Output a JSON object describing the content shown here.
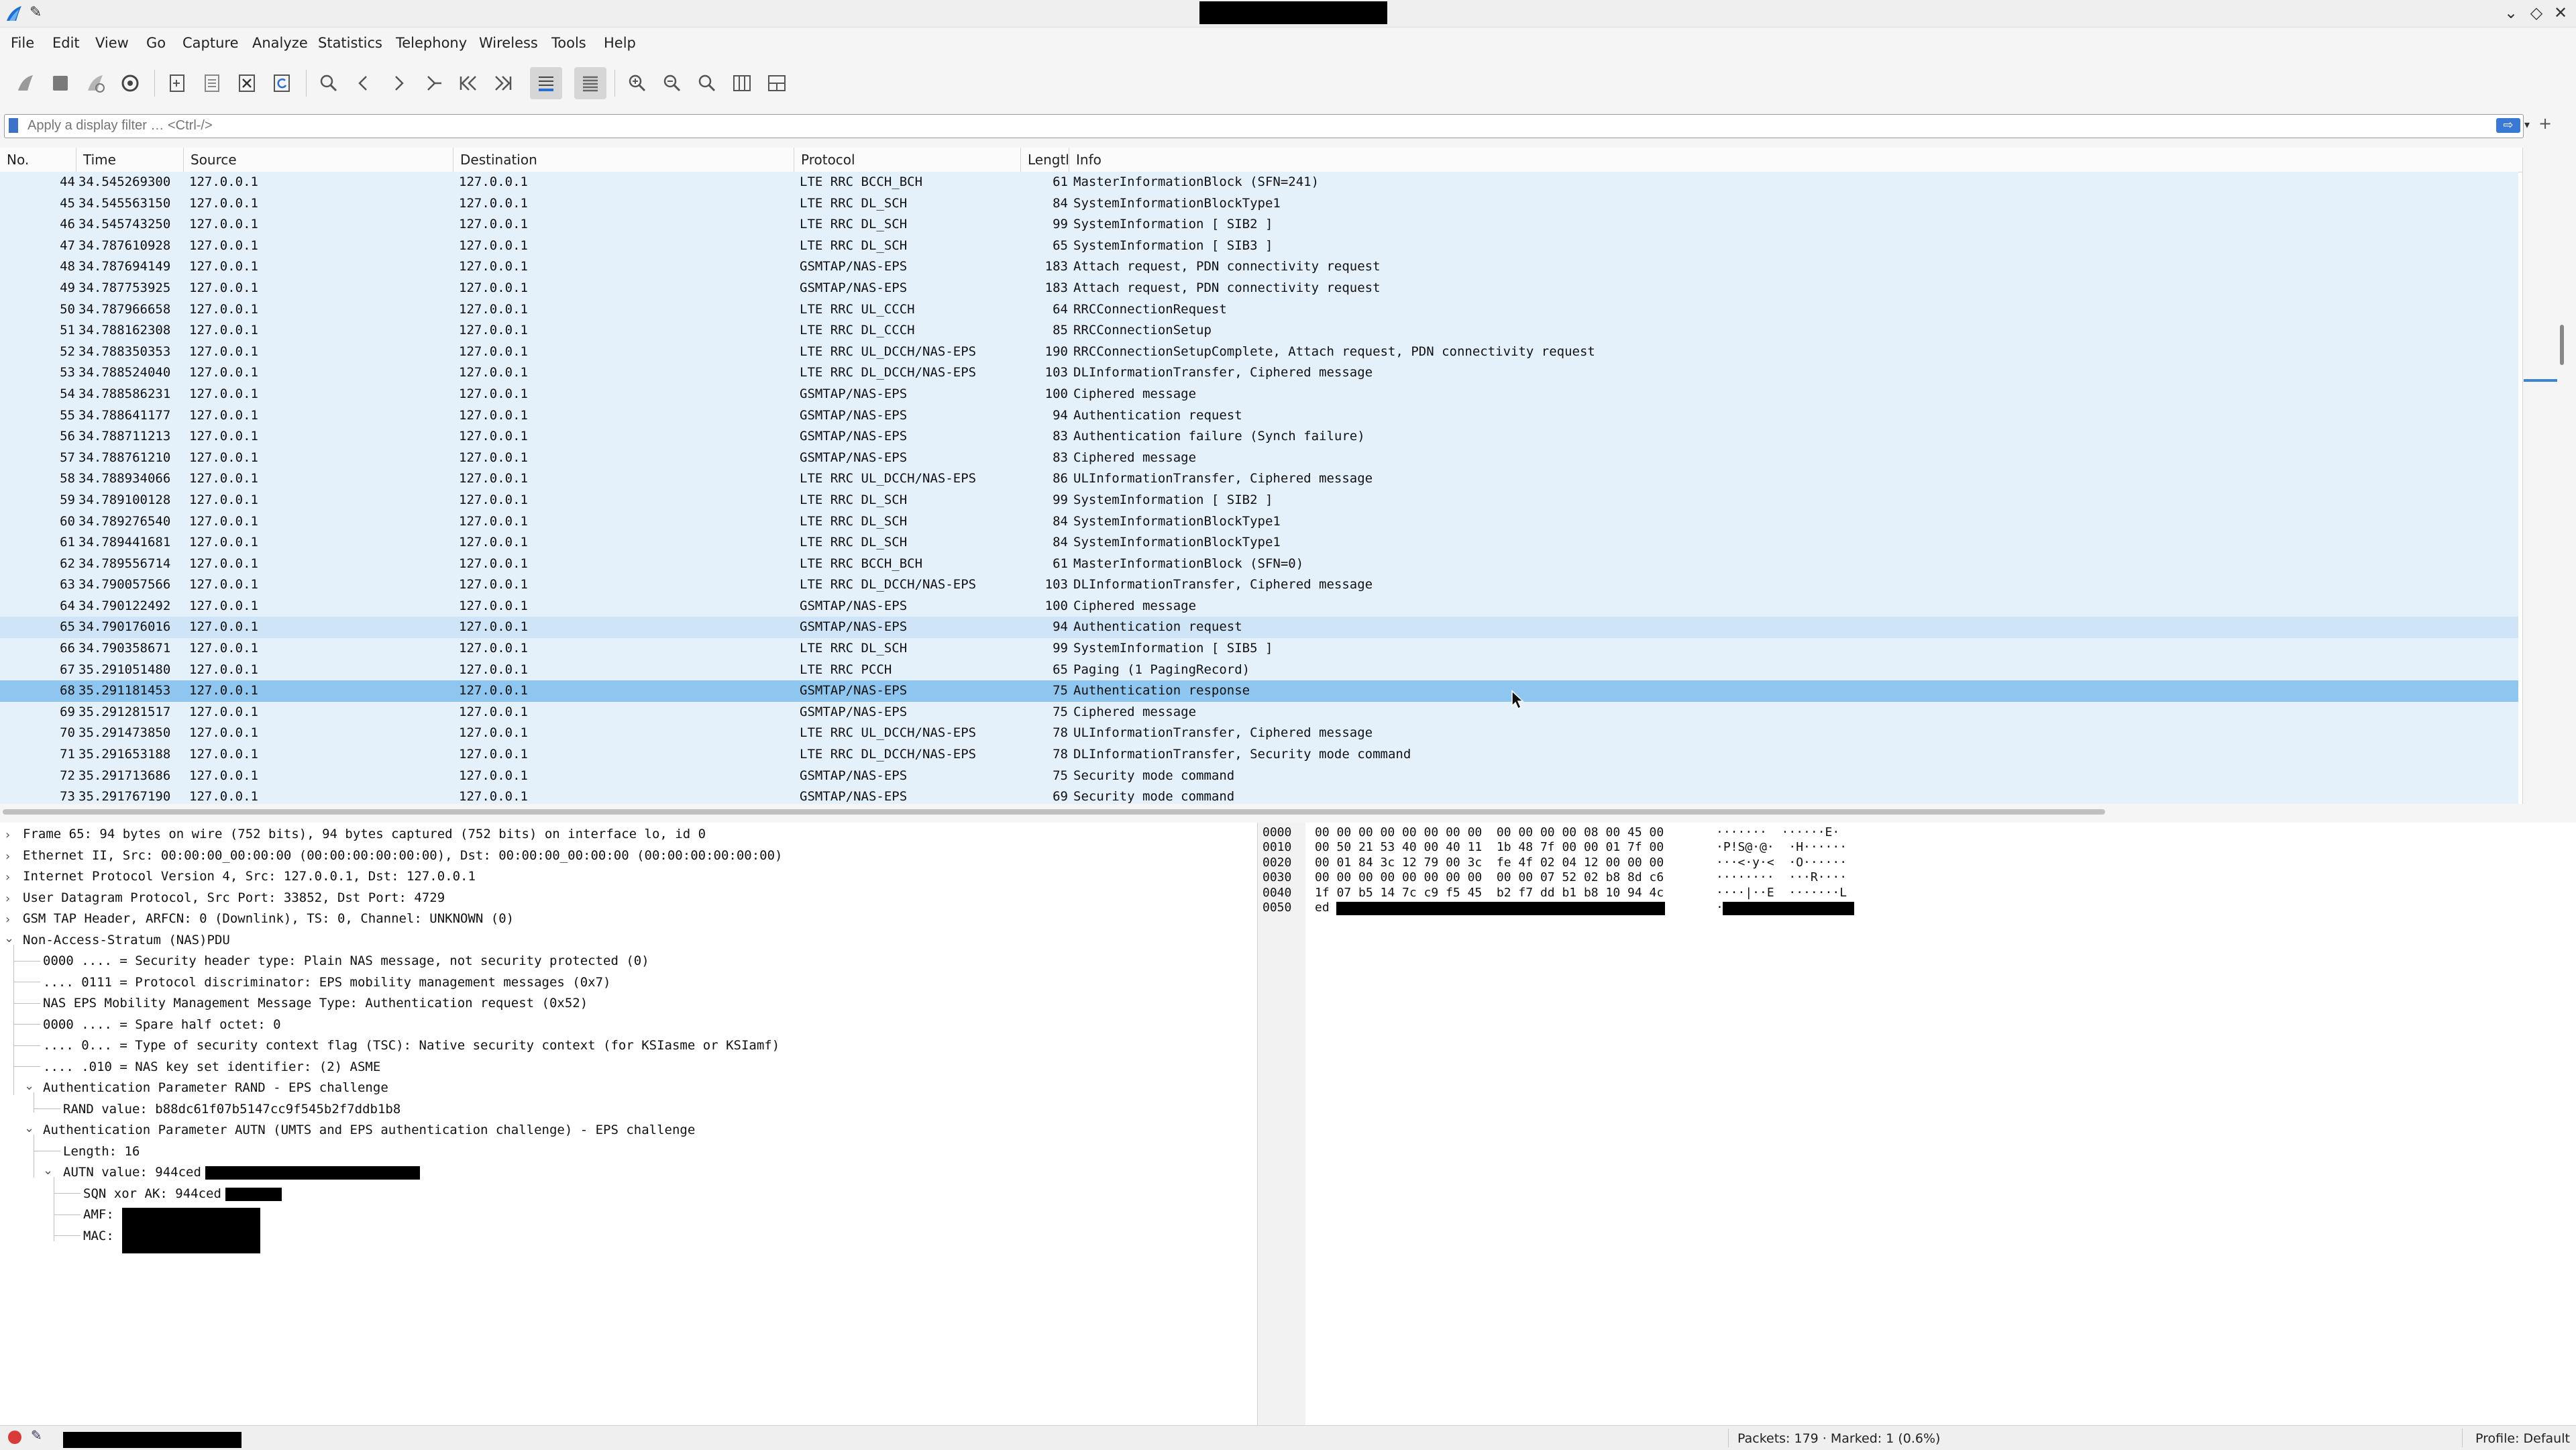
{
  "menu": [
    "File",
    "Edit",
    "View",
    "Go",
    "Capture",
    "Analyze",
    "Statistics",
    "Telephony",
    "Wireless",
    "Tools",
    "Help"
  ],
  "filter": {
    "placeholder": "Apply a display filter … <Ctrl-/>",
    "plus": "+"
  },
  "columns": [
    "No.",
    "Time",
    "Source",
    "Destination",
    "Protocol",
    "Lengtl",
    "Info"
  ],
  "rows": [
    {
      "no": "44",
      "time": "34.545269300",
      "src": "127.0.0.1",
      "dst": "127.0.0.1",
      "proto": "LTE RRC BCCH_BCH",
      "len": "61",
      "info": "MasterInformationBlock (SFN=241)"
    },
    {
      "no": "45",
      "time": "34.545563150",
      "src": "127.0.0.1",
      "dst": "127.0.0.1",
      "proto": "LTE RRC DL_SCH",
      "len": "84",
      "info": "SystemInformationBlockType1"
    },
    {
      "no": "46",
      "time": "34.545743250",
      "src": "127.0.0.1",
      "dst": "127.0.0.1",
      "proto": "LTE RRC DL_SCH",
      "len": "99",
      "info": "SystemInformation [ SIB2 ]"
    },
    {
      "no": "47",
      "time": "34.787610928",
      "src": "127.0.0.1",
      "dst": "127.0.0.1",
      "proto": "LTE RRC DL_SCH",
      "len": "65",
      "info": "SystemInformation [ SIB3 ]"
    },
    {
      "no": "48",
      "time": "34.787694149",
      "src": "127.0.0.1",
      "dst": "127.0.0.1",
      "proto": "GSMTAP/NAS-EPS",
      "len": "183",
      "info": "Attach request, PDN connectivity request"
    },
    {
      "no": "49",
      "time": "34.787753925",
      "src": "127.0.0.1",
      "dst": "127.0.0.1",
      "proto": "GSMTAP/NAS-EPS",
      "len": "183",
      "info": "Attach request, PDN connectivity request"
    },
    {
      "no": "50",
      "time": "34.787966658",
      "src": "127.0.0.1",
      "dst": "127.0.0.1",
      "proto": "LTE RRC UL_CCCH",
      "len": "64",
      "info": "RRCConnectionRequest"
    },
    {
      "no": "51",
      "time": "34.788162308",
      "src": "127.0.0.1",
      "dst": "127.0.0.1",
      "proto": "LTE RRC DL_CCCH",
      "len": "85",
      "info": "RRCConnectionSetup"
    },
    {
      "no": "52",
      "time": "34.788350353",
      "src": "127.0.0.1",
      "dst": "127.0.0.1",
      "proto": "LTE RRC UL_DCCH/NAS-EPS",
      "len": "190",
      "info": "RRCConnectionSetupComplete, Attach request, PDN connectivity request"
    },
    {
      "no": "53",
      "time": "34.788524040",
      "src": "127.0.0.1",
      "dst": "127.0.0.1",
      "proto": "LTE RRC DL_DCCH/NAS-EPS",
      "len": "103",
      "info": "DLInformationTransfer, Ciphered message"
    },
    {
      "no": "54",
      "time": "34.788586231",
      "src": "127.0.0.1",
      "dst": "127.0.0.1",
      "proto": "GSMTAP/NAS-EPS",
      "len": "100",
      "info": "Ciphered message"
    },
    {
      "no": "55",
      "time": "34.788641177",
      "src": "127.0.0.1",
      "dst": "127.0.0.1",
      "proto": "GSMTAP/NAS-EPS",
      "len": "94",
      "info": "Authentication request"
    },
    {
      "no": "56",
      "time": "34.788711213",
      "src": "127.0.0.1",
      "dst": "127.0.0.1",
      "proto": "GSMTAP/NAS-EPS",
      "len": "83",
      "info": "Authentication failure (Synch failure)"
    },
    {
      "no": "57",
      "time": "34.788761210",
      "src": "127.0.0.1",
      "dst": "127.0.0.1",
      "proto": "GSMTAP/NAS-EPS",
      "len": "83",
      "info": "Ciphered message"
    },
    {
      "no": "58",
      "time": "34.788934066",
      "src": "127.0.0.1",
      "dst": "127.0.0.1",
      "proto": "LTE RRC UL_DCCH/NAS-EPS",
      "len": "86",
      "info": "ULInformationTransfer, Ciphered message"
    },
    {
      "no": "59",
      "time": "34.789100128",
      "src": "127.0.0.1",
      "dst": "127.0.0.1",
      "proto": "LTE RRC DL_SCH",
      "len": "99",
      "info": "SystemInformation [ SIB2 ]"
    },
    {
      "no": "60",
      "time": "34.789276540",
      "src": "127.0.0.1",
      "dst": "127.0.0.1",
      "proto": "LTE RRC DL_SCH",
      "len": "84",
      "info": "SystemInformationBlockType1"
    },
    {
      "no": "61",
      "time": "34.789441681",
      "src": "127.0.0.1",
      "dst": "127.0.0.1",
      "proto": "LTE RRC DL_SCH",
      "len": "84",
      "info": "SystemInformationBlockType1"
    },
    {
      "no": "62",
      "time": "34.789556714",
      "src": "127.0.0.1",
      "dst": "127.0.0.1",
      "proto": "LTE RRC BCCH_BCH",
      "len": "61",
      "info": "MasterInformationBlock (SFN=0)"
    },
    {
      "no": "63",
      "time": "34.790057566",
      "src": "127.0.0.1",
      "dst": "127.0.0.1",
      "proto": "LTE RRC DL_DCCH/NAS-EPS",
      "len": "103",
      "info": "DLInformationTransfer, Ciphered message"
    },
    {
      "no": "64",
      "time": "34.790122492",
      "src": "127.0.0.1",
      "dst": "127.0.0.1",
      "proto": "GSMTAP/NAS-EPS",
      "len": "100",
      "info": "Ciphered message"
    },
    {
      "no": "65",
      "time": "34.790176016",
      "src": "127.0.0.1",
      "dst": "127.0.0.1",
      "proto": "GSMTAP/NAS-EPS",
      "len": "94",
      "info": "Authentication request",
      "state": "marked"
    },
    {
      "no": "66",
      "time": "34.790358671",
      "src": "127.0.0.1",
      "dst": "127.0.0.1",
      "proto": "LTE RRC DL_SCH",
      "len": "99",
      "info": "SystemInformation [ SIB5 ]"
    },
    {
      "no": "67",
      "time": "35.291051480",
      "src": "127.0.0.1",
      "dst": "127.0.0.1",
      "proto": "LTE RRC PCCH",
      "len": "65",
      "info": "Paging (1 PagingRecord)"
    },
    {
      "no": "68",
      "time": "35.291181453",
      "src": "127.0.0.1",
      "dst": "127.0.0.1",
      "proto": "GSMTAP/NAS-EPS",
      "len": "75",
      "info": "Authentication response",
      "state": "selected"
    },
    {
      "no": "69",
      "time": "35.291281517",
      "src": "127.0.0.1",
      "dst": "127.0.0.1",
      "proto": "GSMTAP/NAS-EPS",
      "len": "75",
      "info": "Ciphered message"
    },
    {
      "no": "70",
      "time": "35.291473850",
      "src": "127.0.0.1",
      "dst": "127.0.0.1",
      "proto": "LTE RRC UL_DCCH/NAS-EPS",
      "len": "78",
      "info": "ULInformationTransfer, Ciphered message"
    },
    {
      "no": "71",
      "time": "35.291653188",
      "src": "127.0.0.1",
      "dst": "127.0.0.1",
      "proto": "LTE RRC DL_DCCH/NAS-EPS",
      "len": "78",
      "info": "DLInformationTransfer, Security mode command"
    },
    {
      "no": "72",
      "time": "35.291713686",
      "src": "127.0.0.1",
      "dst": "127.0.0.1",
      "proto": "GSMTAP/NAS-EPS",
      "len": "75",
      "info": "Security mode command"
    },
    {
      "no": "73",
      "time": "35.291767190",
      "src": "127.0.0.1",
      "dst": "127.0.0.1",
      "proto": "GSMTAP/NAS-EPS",
      "len": "69",
      "info": "Security mode command"
    }
  ],
  "details": {
    "frame": "Frame 65: 94 bytes on wire (752 bits), 94 bytes captured (752 bits) on interface lo, id 0",
    "ethernet": "Ethernet II, Src: 00:00:00_00:00:00 (00:00:00:00:00:00), Dst: 00:00:00_00:00:00 (00:00:00:00:00:00)",
    "ip": "Internet Protocol Version 4, Src: 127.0.0.1, Dst: 127.0.0.1",
    "udp": "User Datagram Protocol, Src Port: 33852, Dst Port: 4729",
    "gsmtap": "GSM TAP Header, ARFCN: 0 (Downlink), TS: 0, Channel: UNKNOWN (0)",
    "nas": "Non-Access-Stratum (NAS)PDU",
    "sec_header": "0000 .... = Security header type: Plain NAS message, not security protected (0)",
    "proto_disc": ".... 0111 = Protocol discriminator: EPS mobility management messages (0x7)",
    "msg_type": "NAS EPS Mobility Management Message Type: Authentication request (0x52)",
    "spare": "0000 .... = Spare half octet: 0",
    "tsc": ".... 0... = Type of security context flag (TSC): Native security context (for KSIasme or KSIamf)",
    "ksi": ".... .010 = NAS key set identifier:  (2) ASME",
    "rand_param": "Authentication Parameter RAND - EPS challenge",
    "rand_value": "RAND value: b88dc61f07b5147cc9f545b2f7ddb1b8",
    "autn_param": "Authentication Parameter AUTN (UMTS and EPS authentication challenge) - EPS challenge",
    "length": "Length: 16",
    "autn_value": "AUTN value: 944ced",
    "sqn": "SQN xor AK: 944ced",
    "amf": "AMF:",
    "mac": "MAC:"
  },
  "bytes": [
    {
      "off": "0000",
      "hex": "00 00 00 00 00 00 00 00  00 00 00 00 08 00 45 00",
      "ascii": "·······  ······E·"
    },
    {
      "off": "0010",
      "hex": "00 50 21 53 40 00 40 11  1b 48 7f 00 00 01 7f 00",
      "ascii": "·P!S@·@·  ·H······"
    },
    {
      "off": "0020",
      "hex": "00 01 84 3c 12 79 00 3c  fe 4f 02 04 12 00 00 00",
      "ascii": "···<·y·<  ·O······"
    },
    {
      "off": "0030",
      "hex": "00 00 00 00 00 00 00 00  00 00 07 52 02 b8 8d c6",
      "ascii": "········  ···R····"
    },
    {
      "off": "0040",
      "hex": "1f 07 b5 14 7c c9 f5 45  b2 f7 dd b1 b8 10 94 4c",
      "ascii": "····|··E  ·······L"
    },
    {
      "off": "0050",
      "hex": "ed",
      "ascii": "·"
    }
  ],
  "status": {
    "packets": "Packets: 179 · Marked: 1 (0.6%)",
    "profile": "Profile: Default"
  },
  "colors": {
    "row_bg": "#e4f0fa",
    "row_marked": "#cfe4f6",
    "row_selected": "#8fc6ef",
    "accent": "#3a78d6"
  }
}
